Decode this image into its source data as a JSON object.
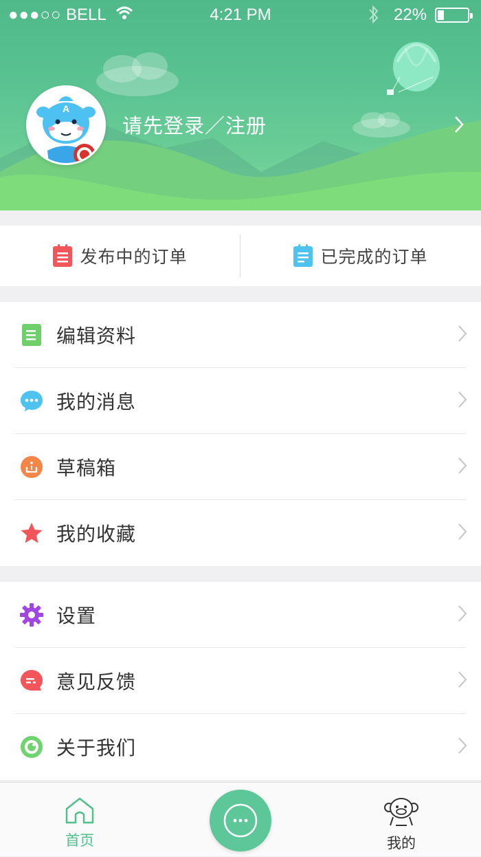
{
  "status_bar": {
    "signal": "●●●○○",
    "carrier": "BELL",
    "time": "4:21 PM",
    "battery_percent": "22%",
    "battery_level": 0.22
  },
  "header": {
    "login_text": "请先登录／注册"
  },
  "orders": {
    "publishing_label": "发布中的订单",
    "completed_label": "已完成的订单"
  },
  "menu": {
    "group1": [
      {
        "label": "编辑资料",
        "icon": "document-icon",
        "color": "#6fcf6a"
      },
      {
        "label": "我的消息",
        "icon": "message-icon",
        "color": "#4fc3f0"
      },
      {
        "label": "草稿箱",
        "icon": "drafts-icon",
        "color": "#f5864a"
      },
      {
        "label": "我的收藏",
        "icon": "star-icon",
        "color": "#f2555a"
      }
    ],
    "group2": [
      {
        "label": "设置",
        "icon": "gear-icon",
        "color": "#a146e0"
      },
      {
        "label": "意见反馈",
        "icon": "feedback-icon",
        "color": "#f2555a"
      },
      {
        "label": "关于我们",
        "icon": "eye-icon",
        "color": "#6fd46f"
      }
    ]
  },
  "tabbar": {
    "home_label": "首页",
    "mine_label": "我的",
    "active_color": "#4fbf8b",
    "inactive_color": "#333333"
  }
}
